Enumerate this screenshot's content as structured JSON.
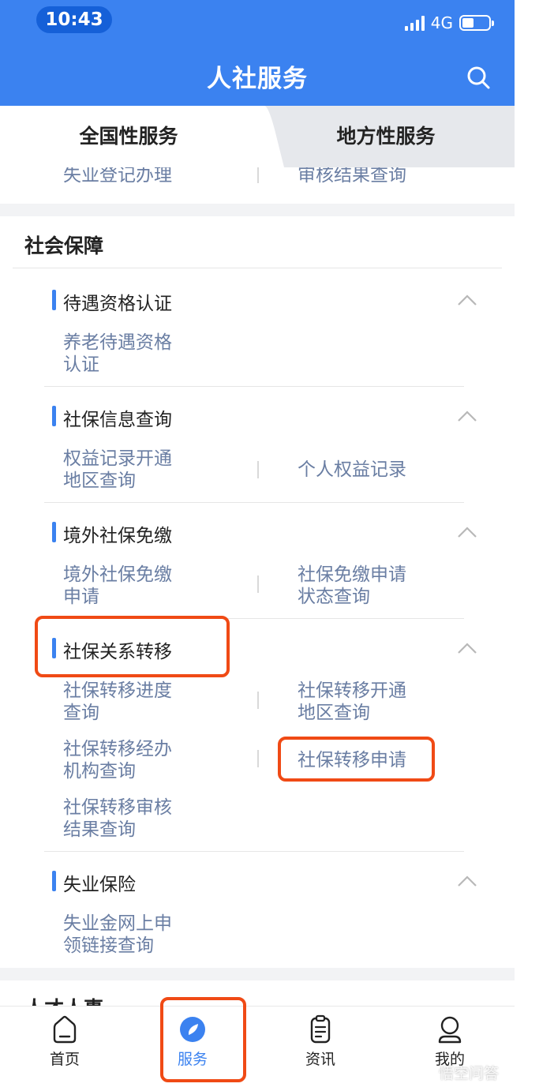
{
  "status_bar": {
    "time": "10:43",
    "network": "4G"
  },
  "header": {
    "title": "人社服务"
  },
  "tabs": [
    {
      "label": "全国性服务",
      "active": true
    },
    {
      "label": "地方性服务",
      "active": false
    }
  ],
  "cut_card": {
    "items": [
      "失业登记办理",
      "审核结果查询"
    ]
  },
  "section": {
    "title": "社会保障",
    "groups": [
      {
        "title": "待遇资格认证",
        "items": [
          {
            "line1": "养老待遇资格",
            "line2": "认证"
          }
        ]
      },
      {
        "title": "社保信息查询",
        "items": [
          {
            "line1": "权益记录开通",
            "line2": "地区查询"
          },
          {
            "line1": "个人权益记录",
            "line2": ""
          }
        ]
      },
      {
        "title": "境外社保免缴",
        "items": [
          {
            "line1": "境外社保免缴",
            "line2": "申请"
          },
          {
            "line1": "社保免缴申请",
            "line2": "状态查询"
          }
        ]
      },
      {
        "title": "社保关系转移",
        "items": [
          {
            "line1": "社保转移进度",
            "line2": "查询"
          },
          {
            "line1": "社保转移开通",
            "line2": "地区查询"
          },
          {
            "line1": "社保转移经办",
            "line2": "机构查询"
          },
          {
            "line1": "社保转移申请",
            "line2": ""
          },
          {
            "line1": "社保转移审核",
            "line2": "结果查询"
          }
        ]
      },
      {
        "title": "失业保险",
        "items": [
          {
            "line1": "失业金网上申",
            "line2": "领链接查询"
          }
        ]
      }
    ]
  },
  "next_card": {
    "title": "人才人事"
  },
  "tabbar": [
    {
      "label": "首页",
      "icon": "home-icon",
      "active": false
    },
    {
      "label": "服务",
      "icon": "compass-icon",
      "active": true
    },
    {
      "label": "资讯",
      "icon": "clipboard-icon",
      "active": false
    },
    {
      "label": "我的",
      "icon": "user-icon",
      "active": false
    }
  ],
  "watermark": "悟空问答",
  "colors": {
    "primary": "#3b82f0",
    "highlight": "#f04a15",
    "item_text": "#6a7ea3"
  }
}
